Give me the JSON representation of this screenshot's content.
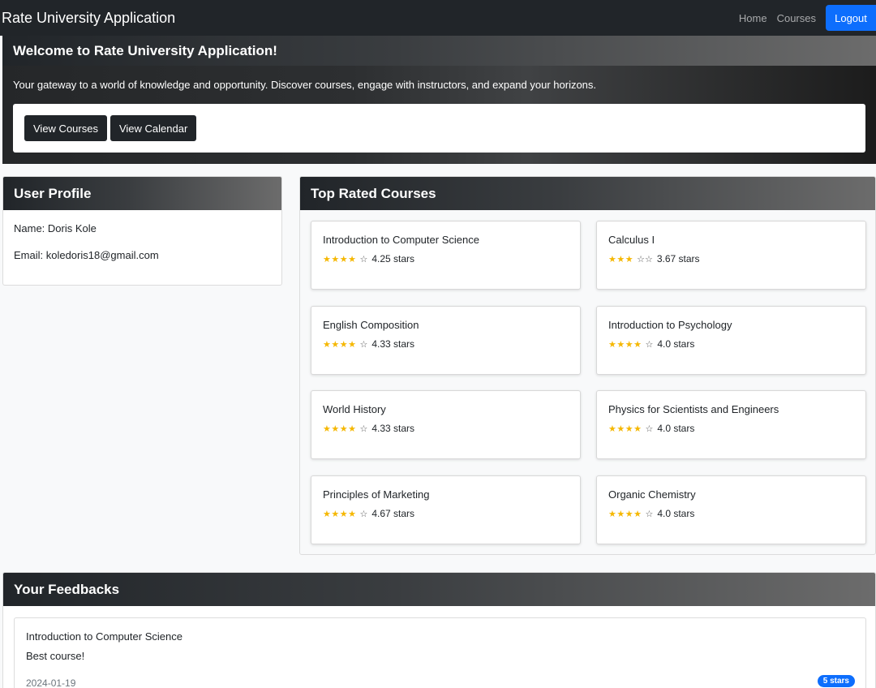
{
  "navbar": {
    "brand": "Rate University Application",
    "home": "Home",
    "courses": "Courses",
    "logout": "Logout"
  },
  "welcome": {
    "title": "Welcome to Rate University Application!",
    "text": "Your gateway to a world of knowledge and opportunity. Discover courses, engage with instructors, and expand your horizons.",
    "view_courses": "View Courses",
    "view_calendar": "View Calendar"
  },
  "profile": {
    "title": "User Profile",
    "name": "Name: Doris Kole",
    "email": "Email: koledoris18@gmail.com"
  },
  "top_courses": {
    "title": "Top Rated Courses",
    "items": [
      {
        "name": "Introduction to Computer Science",
        "full": "★★★★",
        "empty": "☆",
        "rating": "4.25 stars"
      },
      {
        "name": "Calculus I",
        "full": "★★★",
        "empty": "☆☆",
        "rating": "3.67 stars"
      },
      {
        "name": "English Composition",
        "full": "★★★★",
        "empty": "☆",
        "rating": "4.33 stars"
      },
      {
        "name": "Introduction to Psychology",
        "full": "★★★★",
        "empty": "☆",
        "rating": "4.0 stars"
      },
      {
        "name": "World History",
        "full": "★★★★",
        "empty": "☆",
        "rating": "4.33 stars"
      },
      {
        "name": "Physics for Scientists and Engineers",
        "full": "★★★★",
        "empty": "☆",
        "rating": "4.0 stars"
      },
      {
        "name": "Principles of Marketing",
        "full": "★★★★",
        "empty": "☆",
        "rating": "4.67 stars"
      },
      {
        "name": "Organic Chemistry",
        "full": "★★★★",
        "empty": "☆",
        "rating": "4.0 stars"
      }
    ]
  },
  "feedbacks": {
    "title": "Your Feedbacks",
    "items": [
      {
        "course": "Introduction to Computer Science",
        "comment": "Best course!",
        "date": "2024-01-19",
        "badge": "5 stars"
      }
    ]
  },
  "colors": {
    "accent": "#0d6efd",
    "dark": "#212529",
    "star": "#f5b700"
  }
}
